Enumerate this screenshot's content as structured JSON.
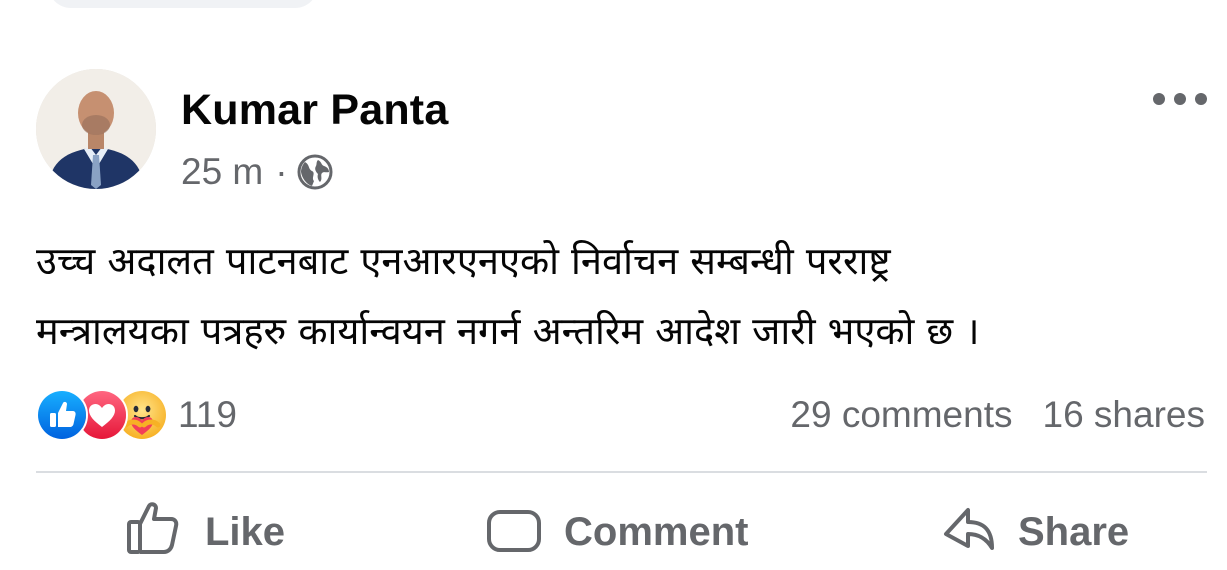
{
  "post": {
    "author": "Kumar Panta",
    "time": "25 m",
    "separator": "·",
    "privacy_icon": "globe-icon",
    "text_line1": "उच्च अदालत पाटनबाट एनआरएनएको निर्वाचन सम्बन्धी परराष्ट्र",
    "text_line2": "मन्त्रालयका पत्रहरु कार्यान्वयन नगर्न अन्तरिम आदेश जारी भएको छ ।"
  },
  "reactions": {
    "icons": [
      "like-icon",
      "love-icon",
      "care-icon"
    ],
    "count": "119"
  },
  "stats": {
    "comments": "29 comments",
    "shares": "16 shares"
  },
  "actions": {
    "like": "Like",
    "comment": "Comment",
    "share": "Share"
  },
  "colors": {
    "like_blue": "#1877f2",
    "love_red": "#f33e58",
    "care_yellow": "#f7b125",
    "secondary_text": "#65676b",
    "primary_text": "#050505",
    "divider": "#dadde1"
  }
}
